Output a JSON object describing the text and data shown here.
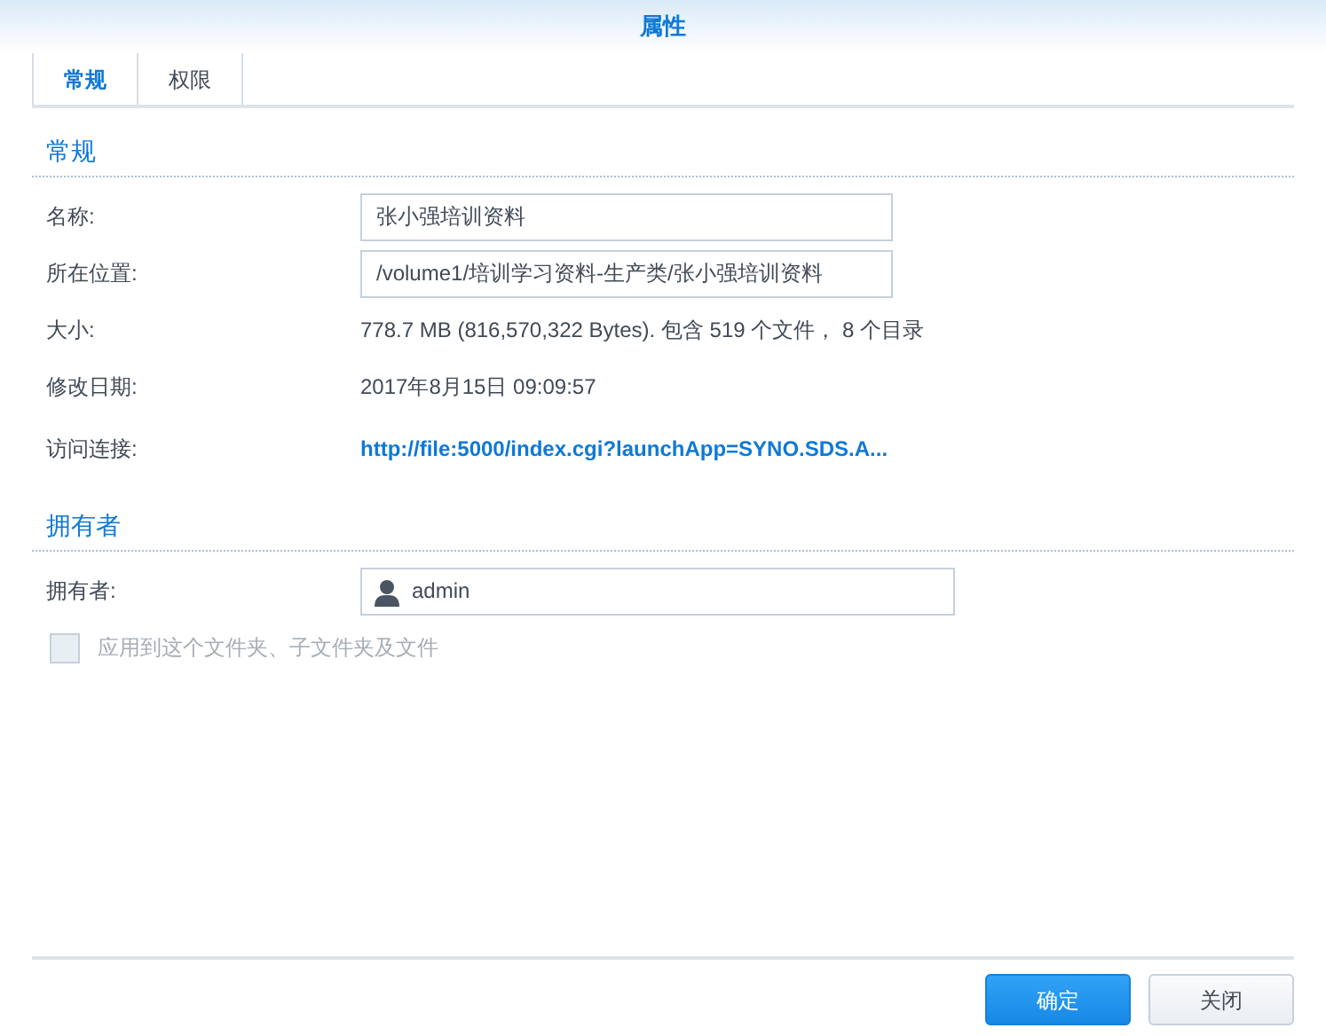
{
  "window": {
    "title": "属性"
  },
  "tabs": [
    {
      "label": "常规",
      "selected": true
    },
    {
      "label": "权限",
      "selected": false
    }
  ],
  "sections": [
    {
      "heading": "常规",
      "rows": [
        {
          "kind": "field",
          "label": "名称:",
          "value": "张小强培训资料"
        },
        {
          "kind": "field",
          "label": "所在位置:",
          "value": "/volume1/培训学习资料-生产类/张小强培训资料"
        },
        {
          "kind": "text",
          "label": "大小:",
          "value": "778.7 MB (816,570,322 Bytes). 包含 519 个文件， 8 个目录"
        },
        {
          "kind": "text",
          "label": "修改日期:",
          "value": "2017年8月15日 09:09:57"
        },
        {
          "kind": "link",
          "label": "访问连接:",
          "value": "http://file:5000/index.cgi?launchApp=SYNO.SDS.A..."
        }
      ]
    },
    {
      "heading": "拥有者",
      "rows": [
        {
          "kind": "user",
          "label": "拥有者:",
          "value": "admin"
        },
        {
          "kind": "checkbox",
          "label": "应用到这个文件夹、子文件夹及文件",
          "checked": false,
          "disabled": true
        }
      ]
    }
  ],
  "buttons": [
    {
      "label": "确定",
      "primary": true
    },
    {
      "label": "关闭",
      "primary": false
    }
  ]
}
